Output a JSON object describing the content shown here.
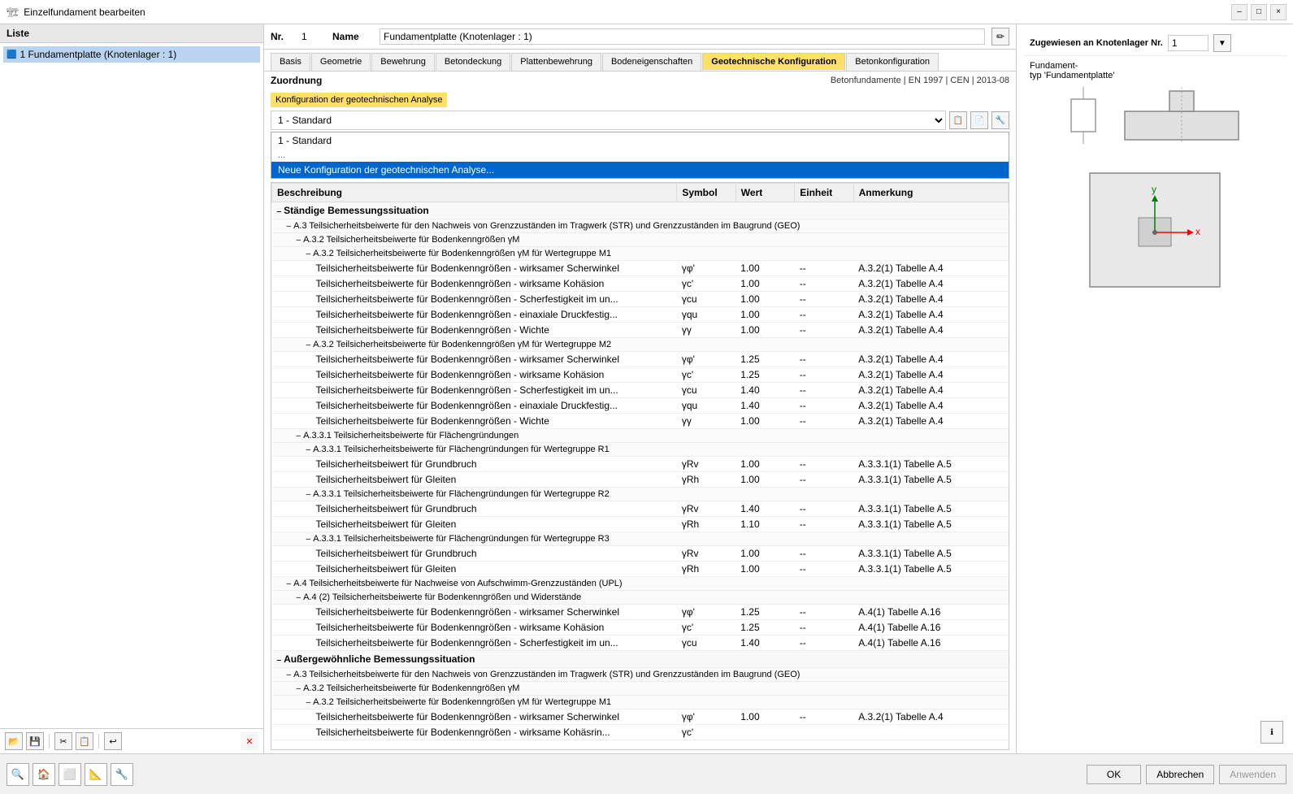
{
  "window": {
    "title": "Einzelfundament bearbeiten",
    "minimize_label": "–",
    "maximize_label": "□",
    "close_label": "×"
  },
  "left_panel": {
    "header": "Liste",
    "items": [
      {
        "id": 1,
        "label": "1  Fundamentplatte (Knotenlager : 1)"
      }
    ],
    "toolbar_btns": [
      "📂",
      "💾",
      "✂",
      "📋",
      "↩"
    ],
    "delete_btn": "×"
  },
  "form": {
    "nr_label": "Nr.",
    "nr_value": "1",
    "name_label": "Name",
    "name_value": "Fundamentplatte (Knotenlager : 1)",
    "edit_icon": "✏"
  },
  "tabs": [
    {
      "id": "basis",
      "label": "Basis"
    },
    {
      "id": "geometrie",
      "label": "Geometrie"
    },
    {
      "id": "bewehrung",
      "label": "Bewehrung"
    },
    {
      "id": "betondeckung",
      "label": "Betondeckung"
    },
    {
      "id": "plattenbewehrung",
      "label": "Plattenbewehrung"
    },
    {
      "id": "bodeneigenschaften",
      "label": "Bodeneigenschaften"
    },
    {
      "id": "geotechnische",
      "label": "Geotechnische Konfiguration",
      "active": true
    },
    {
      "id": "betonkonfiguration",
      "label": "Betonkonfiguration"
    }
  ],
  "zuordnung": {
    "label": "Zuordnung",
    "norm": "Betonfundamente | EN 1997 | CEN | 2013-08"
  },
  "config": {
    "label": "Konfiguration der geotechnischen Analyse",
    "selected": "1 - Standard",
    "options": [
      {
        "value": "1 - Standard",
        "label": "1 - Standard"
      },
      {
        "value": "neue",
        "label": "Neue Konfiguration der geotechnischen Analyse..."
      }
    ],
    "btns": [
      "📋",
      "📄",
      "🔧"
    ]
  },
  "table": {
    "columns": [
      "Beschreibung",
      "Symbol",
      "Wert",
      "Einheit",
      "Anmerkung"
    ],
    "rows": [
      {
        "type": "section",
        "indent": 0,
        "label": "Ständige Bemessungssituation",
        "expand": "–"
      },
      {
        "type": "sub",
        "indent": 1,
        "label": "A.3 Teilsicherheitsbeiwerte für den Nachweis von Grenzzuständen im Tragwerk (STR) und Grenzzuständen im Baugrund (GEO)",
        "expand": "–"
      },
      {
        "type": "sub",
        "indent": 2,
        "label": "A.3.2 Teilsicherheitsbeiwerte für Bodenkenngrößen γM",
        "expand": "–"
      },
      {
        "type": "sub",
        "indent": 3,
        "label": "A.3.2 Teilsicherheitsbeiwerte für Bodenkenngrößen γM für Wertegruppe M1",
        "expand": "–"
      },
      {
        "type": "data",
        "indent": 4,
        "desc": "Teilsicherheitsbeiwerte für Bodenkenngrößen - wirksamer Scherwinkel",
        "symbol": "γφ'",
        "wert": "1.00",
        "einheit": "--",
        "anmerkung": "A.3.2(1) Tabelle A.4"
      },
      {
        "type": "data",
        "indent": 4,
        "desc": "Teilsicherheitsbeiwerte für Bodenkenngrößen - wirksame Kohäsion",
        "symbol": "γc'",
        "wert": "1.00",
        "einheit": "--",
        "anmerkung": "A.3.2(1) Tabelle A.4"
      },
      {
        "type": "data",
        "indent": 4,
        "desc": "Teilsicherheitsbeiwerte für Bodenkenngrößen - Scherfestigkeit im un...",
        "symbol": "γcu",
        "wert": "1.00",
        "einheit": "--",
        "anmerkung": "A.3.2(1) Tabelle A.4"
      },
      {
        "type": "data",
        "indent": 4,
        "desc": "Teilsicherheitsbeiwerte für Bodenkenngrößen - einaxiale Druckfestig...",
        "symbol": "γqu",
        "wert": "1.00",
        "einheit": "--",
        "anmerkung": "A.3.2(1) Tabelle A.4"
      },
      {
        "type": "data",
        "indent": 4,
        "desc": "Teilsicherheitsbeiwerte für Bodenkenngrößen - Wichte",
        "symbol": "γγ",
        "wert": "1.00",
        "einheit": "--",
        "anmerkung": "A.3.2(1) Tabelle A.4"
      },
      {
        "type": "sub",
        "indent": 3,
        "label": "A.3.2 Teilsicherheitsbeiwerte für Bodenkenngrößen γM für Wertegruppe M2",
        "expand": "–"
      },
      {
        "type": "data",
        "indent": 4,
        "desc": "Teilsicherheitsbeiwerte für Bodenkenngrößen - wirksamer Scherwinkel",
        "symbol": "γφ'",
        "wert": "1.25",
        "einheit": "--",
        "anmerkung": "A.3.2(1) Tabelle A.4"
      },
      {
        "type": "data",
        "indent": 4,
        "desc": "Teilsicherheitsbeiwerte für Bodenkenngrößen - wirksame Kohäsion",
        "symbol": "γc'",
        "wert": "1.25",
        "einheit": "--",
        "anmerkung": "A.3.2(1) Tabelle A.4"
      },
      {
        "type": "data",
        "indent": 4,
        "desc": "Teilsicherheitsbeiwerte für Bodenkenngrößen - Scherfestigkeit im un...",
        "symbol": "γcu",
        "wert": "1.40",
        "einheit": "--",
        "anmerkung": "A.3.2(1) Tabelle A.4"
      },
      {
        "type": "data",
        "indent": 4,
        "desc": "Teilsicherheitsbeiwerte für Bodenkenngrößen - einaxiale Druckfestig...",
        "symbol": "γqu",
        "wert": "1.40",
        "einheit": "--",
        "anmerkung": "A.3.2(1) Tabelle A.4"
      },
      {
        "type": "data",
        "indent": 4,
        "desc": "Teilsicherheitsbeiwerte für Bodenkenngrößen - Wichte",
        "symbol": "γγ",
        "wert": "1.00",
        "einheit": "--",
        "anmerkung": "A.3.2(1) Tabelle A.4"
      },
      {
        "type": "sub",
        "indent": 2,
        "label": "A.3.3.1 Teilsicherheitsbeiwerte für Flächengründungen",
        "expand": "–"
      },
      {
        "type": "sub",
        "indent": 3,
        "label": "A.3.3.1 Teilsicherheitsbeiwerte für Flächengründungen für Wertegruppe R1",
        "expand": "–"
      },
      {
        "type": "data",
        "indent": 4,
        "desc": "Teilsicherheitsbeiwert für Grundbruch",
        "symbol": "γRv",
        "wert": "1.00",
        "einheit": "--",
        "anmerkung": "A.3.3.1(1) Tabelle A.5"
      },
      {
        "type": "data",
        "indent": 4,
        "desc": "Teilsicherheitsbeiwert für Gleiten",
        "symbol": "γRh",
        "wert": "1.00",
        "einheit": "--",
        "anmerkung": "A.3.3.1(1) Tabelle A.5"
      },
      {
        "type": "sub",
        "indent": 3,
        "label": "A.3.3.1 Teilsicherheitsbeiwerte für Flächengründungen für Wertegruppe R2",
        "expand": "–"
      },
      {
        "type": "data",
        "indent": 4,
        "desc": "Teilsicherheitsbeiwert für Grundbruch",
        "symbol": "γRv",
        "wert": "1.40",
        "einheit": "--",
        "anmerkung": "A.3.3.1(1) Tabelle A.5"
      },
      {
        "type": "data",
        "indent": 4,
        "desc": "Teilsicherheitsbeiwert für Gleiten",
        "symbol": "γRh",
        "wert": "1.10",
        "einheit": "--",
        "anmerkung": "A.3.3.1(1) Tabelle A.5"
      },
      {
        "type": "sub",
        "indent": 3,
        "label": "A.3.3.1 Teilsicherheitsbeiwerte für Flächengründungen für Wertegruppe R3",
        "expand": "–"
      },
      {
        "type": "data",
        "indent": 4,
        "desc": "Teilsicherheitsbeiwert für Grundbruch",
        "symbol": "γRv",
        "wert": "1.00",
        "einheit": "--",
        "anmerkung": "A.3.3.1(1) Tabelle A.5"
      },
      {
        "type": "data",
        "indent": 4,
        "desc": "Teilsicherheitsbeiwert für Gleiten",
        "symbol": "γRh",
        "wert": "1.00",
        "einheit": "--",
        "anmerkung": "A.3.3.1(1) Tabelle A.5"
      },
      {
        "type": "sub",
        "indent": 1,
        "label": "A.4 Teilsicherheitsbeiwerte für Nachweise von Aufschwimm-Grenzzuständen (UPL)",
        "expand": "–"
      },
      {
        "type": "sub",
        "indent": 2,
        "label": "A.4 (2) Teilsicherheitsbeiwerte für Bodenkenngrößen und Widerstände",
        "expand": "–"
      },
      {
        "type": "data",
        "indent": 4,
        "desc": "Teilsicherheitsbeiwerte für Bodenkenngrößen - wirksamer Scherwinkel",
        "symbol": "γφ'",
        "wert": "1.25",
        "einheit": "--",
        "anmerkung": "A.4(1) Tabelle A.16"
      },
      {
        "type": "data",
        "indent": 4,
        "desc": "Teilsicherheitsbeiwerte für Bodenkenngrößen - wirksame Kohäsion",
        "symbol": "γc'",
        "wert": "1.25",
        "einheit": "--",
        "anmerkung": "A.4(1) Tabelle A.16"
      },
      {
        "type": "data",
        "indent": 4,
        "desc": "Teilsicherheitsbeiwerte für Bodenkenngrößen - Scherfestigkeit im un...",
        "symbol": "γcu",
        "wert": "1.40",
        "einheit": "--",
        "anmerkung": "A.4(1) Tabelle A.16"
      },
      {
        "type": "section",
        "indent": 0,
        "label": "Außergewöhnliche Bemessungssituation",
        "expand": "–"
      },
      {
        "type": "sub",
        "indent": 1,
        "label": "A.3 Teilsicherheitsbeiwerte für den Nachweis von Grenzzuständen im Tragwerk (STR) und Grenzzuständen im Baugrund (GEO)",
        "expand": "–"
      },
      {
        "type": "sub",
        "indent": 2,
        "label": "A.3.2 Teilsicherheitsbeiwerte für Bodenkenngrößen γM",
        "expand": "–"
      },
      {
        "type": "sub",
        "indent": 3,
        "label": "A.3.2 Teilsicherheitsbeiwerte für Bodenkenngrößen γM für Wertegruppe M1",
        "expand": "–"
      },
      {
        "type": "data",
        "indent": 4,
        "desc": "Teilsicherheitsbeiwerte für Bodenkenngrößen - wirksamer Scherwinkel",
        "symbol": "γφ'",
        "wert": "1.00",
        "einheit": "--",
        "anmerkung": "A.3.2(1) Tabelle A.4"
      },
      {
        "type": "data",
        "indent": 4,
        "desc": "Teilsicherheitsbeiwerte für Bodenkenngrößen - wirksame Kohäsrin...",
        "symbol": "γc'",
        "wert": "",
        "einheit": "",
        "anmerkung": ""
      }
    ]
  },
  "right_panel": {
    "zuweisen_header": "Zugewiesen an Knotenlager Nr.",
    "zuweisen_value": "1",
    "fundament_label": "Fundament-",
    "fundament_sub": "typ 'Fundamentplatte'"
  },
  "bottom_toolbar": {
    "tools": [
      "🔍",
      "🏠",
      "⬜",
      "📐",
      "🔧"
    ],
    "ok_label": "OK",
    "cancel_label": "Abbrechen",
    "apply_label": "Anwenden"
  }
}
